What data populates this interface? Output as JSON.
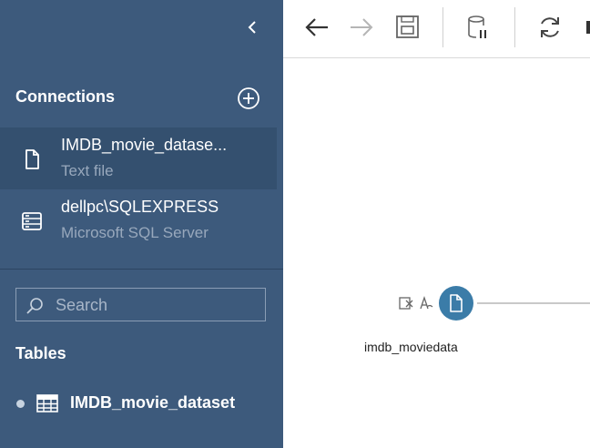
{
  "sidebar": {
    "connections_header": "Connections",
    "connections": [
      {
        "name": "IMDB_movie_datase...",
        "type": "Text file",
        "icon": "file-icon",
        "selected": true
      },
      {
        "name": "dellpc\\SQLEXPRESS",
        "type": "Microsoft SQL Server",
        "icon": "database-server-icon",
        "selected": false
      }
    ],
    "search": {
      "placeholder": "Search"
    },
    "tables_header": "Tables",
    "tables": [
      {
        "label": "IMDB_movie_dataset",
        "icon": "table-grid-icon"
      }
    ]
  },
  "toolbar": {
    "buttons": [
      "back-arrow-icon",
      "forward-arrow-icon",
      "save-icon",
      "pause-data-updates-icon",
      "refresh-icon"
    ]
  },
  "canvas": {
    "node_label": "imdb_moviedata"
  },
  "colors": {
    "sidebar_bg": "#3d5a7c",
    "selected_bg": "#34506f",
    "node_accent": "#3b7ca8"
  }
}
